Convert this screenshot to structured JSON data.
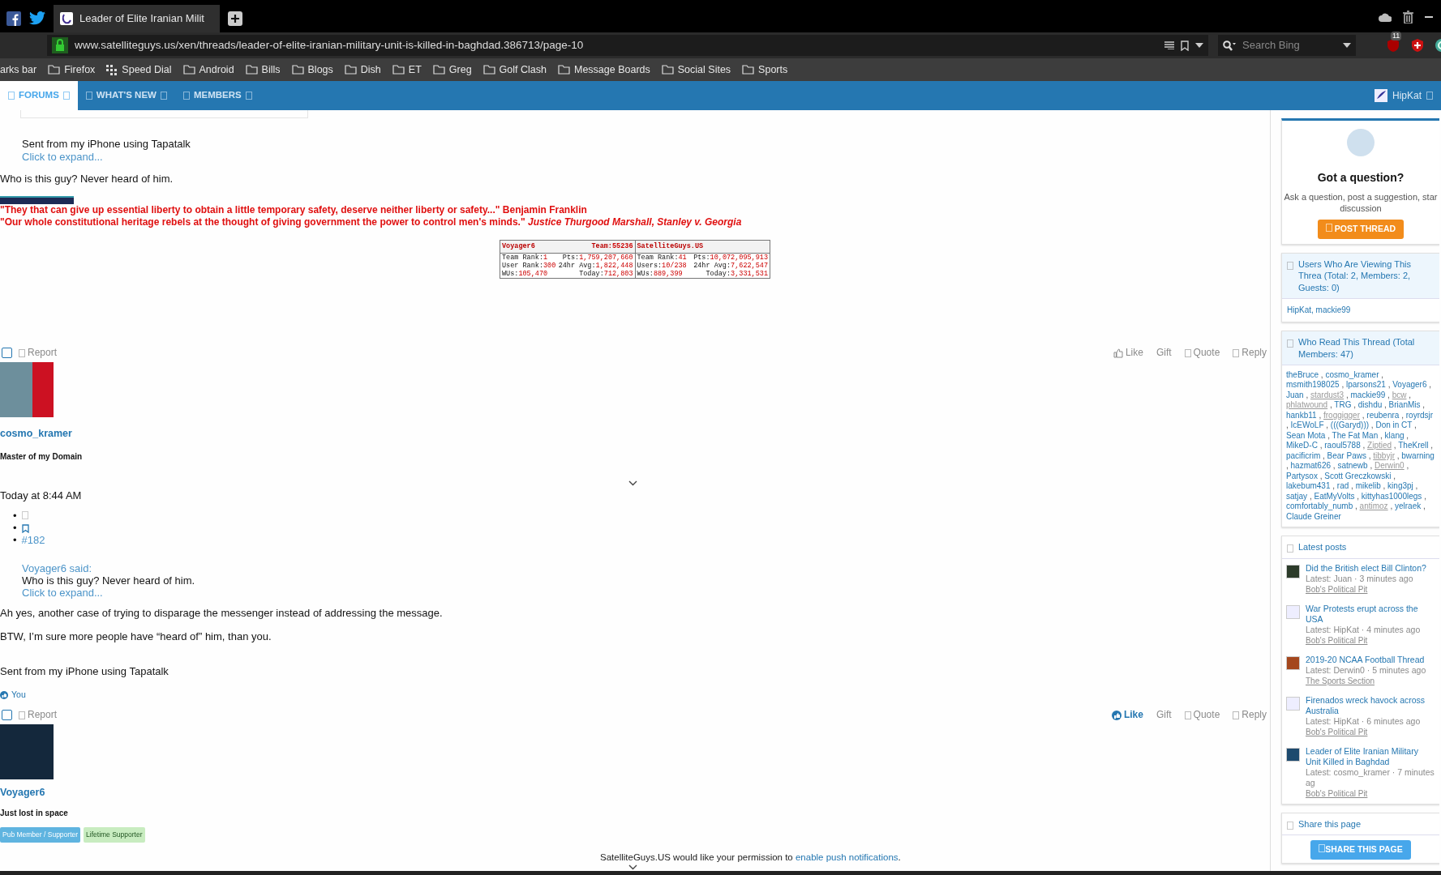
{
  "browser": {
    "tabs": [
      {
        "title": "Leader of Elite Iranian Milit",
        "selected": true
      }
    ],
    "url": "www.satelliteguys.us/xen/threads/leader-of-elite-iranian-military-unit-is-killed-in-baghdad.386713/page-10",
    "search": {
      "placeholder": "Search Bing"
    },
    "extension_badge": "11",
    "bookmarks": [
      {
        "label": "arks bar",
        "kind": "text"
      },
      {
        "label": "Firefox",
        "kind": "folder"
      },
      {
        "label": "Speed Dial",
        "kind": "grid"
      },
      {
        "label": "Android",
        "kind": "folder"
      },
      {
        "label": "Bills",
        "kind": "folder"
      },
      {
        "label": "Blogs",
        "kind": "folder"
      },
      {
        "label": "Dish",
        "kind": "folder"
      },
      {
        "label": "ET",
        "kind": "folder"
      },
      {
        "label": "Greg",
        "kind": "folder"
      },
      {
        "label": "Golf Clash",
        "kind": "folder"
      },
      {
        "label": "Message Boards",
        "kind": "folder"
      },
      {
        "label": "Social Sites",
        "kind": "folder"
      },
      {
        "label": "Sports",
        "kind": "folder"
      }
    ]
  },
  "site_nav": {
    "items": [
      {
        "label": "FORUMS",
        "selected": true
      },
      {
        "label": "WHAT'S NEW",
        "selected": false
      },
      {
        "label": "MEMBERS",
        "selected": false
      }
    ],
    "user": "HipKat"
  },
  "top_post": {
    "quote_footer": "Sent from my iPhone using Tapatalk",
    "expand": "Click to expand...",
    "body": "Who is this guy? Never heard of him.",
    "signature": [
      "\"They that can give up essential liberty to obtain a little temporary safety, deserve neither liberty or safety...\" Benjamin Franklin",
      "\"Our whole constitutional heritage rebels at the thought of giving government the power to control men's minds.\" *Justice Thurgood Marshall, Stanley v. Georgia*"
    ],
    "stats": [
      {
        "name": "Voyager6",
        "label": "Team:",
        "value": "55236",
        "rows": [
          [
            [
              "Team Rank:",
              "1"
            ],
            [
              "Pts:",
              "1,759,207,660"
            ]
          ],
          [
            [
              "User Rank:",
              "300"
            ],
            [
              "24hr Avg:",
              "1,822,448"
            ]
          ],
          [
            [
              "WUs:",
              "105,470"
            ],
            [
              "Today:",
              "712,803"
            ]
          ]
        ]
      },
      {
        "name": "SatelliteGuys.US",
        "rows": [
          [
            [
              "Team Rank:",
              "41"
            ],
            [
              "Pts:",
              "10,072,095,913"
            ]
          ],
          [
            [
              "Users:",
              "10/238"
            ],
            [
              "24hr Avg:",
              "7,622,547"
            ]
          ],
          [
            [
              "WUs:",
              "889,399"
            ],
            [
              "Today:",
              "3,331,531"
            ]
          ]
        ]
      }
    ],
    "actions": {
      "selected": false,
      "report": "Report",
      "liked": false,
      "like": "Like",
      "gift": "Gift",
      "quote": "Quote",
      "reply": "Reply"
    }
  },
  "post": {
    "author": "cosmo_kramer",
    "user_title": "Master of my Domain",
    "date": "Today at 8:44 AM",
    "post_number": "#182",
    "bullet": "•",
    "quote": {
      "source": "Voyager6 said:",
      "text": "Who is this guy? Never heard of him.",
      "expand": "Click to expand..."
    },
    "paragraphs": [
      "Ah yes, another case of trying to disparage the messenger instead of addressing the message.",
      "BTW, I’m sure more people have “heard of” him, than you.",
      "Sent from my iPhone using Tapatalk"
    ],
    "reactions": "You",
    "actions": {
      "selected": false,
      "report": "Report",
      "liked": true,
      "like": "Like",
      "gift": "Gift",
      "quote": "Quote",
      "reply": "Reply"
    }
  },
  "next_post": {
    "author": "Voyager6",
    "user_title": "Just lost in space",
    "banners": [
      {
        "label": "Pub Member / Supporter",
        "color": "#5fb4e0"
      },
      {
        "label": "Lifetime Supporter",
        "color": "#c8ecc0"
      }
    ]
  },
  "notice": {
    "text": "SatelliteGuys.US would like your permission to ",
    "link": "enable push notifications",
    "end": "."
  },
  "sidebar": {
    "question": {
      "title": "Got a question?",
      "text": "Ask a question, post a suggestion, star discussion",
      "button": "POST THREAD"
    },
    "viewing": {
      "title": "Users Who Are Viewing This Threa (Total: 2, Members: 2, Guests: 0)",
      "users": "HipKat, mackie99"
    },
    "readers": {
      "title": "Who Read This Thread (Total Members: 47)",
      "names": [
        {
          "name": "theBruce",
          "muted": false
        },
        {
          "name": "cosmo_kramer",
          "muted": false
        },
        {
          "name": "msmith198025",
          "muted": false
        },
        {
          "name": "lparsons21",
          "muted": false
        },
        {
          "name": "Voyager6",
          "muted": false
        },
        {
          "name": "Juan",
          "muted": false
        },
        {
          "name": "stardust3",
          "muted": true
        },
        {
          "name": "mackie99",
          "muted": false
        },
        {
          "name": "bcw",
          "muted": true
        },
        {
          "name": "phlatwound",
          "muted": true
        },
        {
          "name": "TRG",
          "muted": false
        },
        {
          "name": "dishdu",
          "muted": false
        },
        {
          "name": "BrianMis",
          "muted": false
        },
        {
          "name": "hankb11",
          "muted": false
        },
        {
          "name": "froggigger",
          "muted": true
        },
        {
          "name": "reubenra",
          "muted": false
        },
        {
          "name": "royrdsjr",
          "muted": false
        },
        {
          "name": "IcEWoLF",
          "muted": false
        },
        {
          "name": "(((Garyd)))",
          "muted": false
        },
        {
          "name": "Don in CT",
          "muted": false
        },
        {
          "name": "Sean Mota",
          "muted": false
        },
        {
          "name": "The Fat Man",
          "muted": false
        },
        {
          "name": "klang",
          "muted": false
        },
        {
          "name": "MikeD-C",
          "muted": false
        },
        {
          "name": "raoul5788",
          "muted": false
        },
        {
          "name": "Ziptied",
          "muted": true
        },
        {
          "name": "TheKrell",
          "muted": false
        },
        {
          "name": "pacificrim",
          "muted": false
        },
        {
          "name": "Bear Paws",
          "muted": false
        },
        {
          "name": "tibbyjr",
          "muted": true
        },
        {
          "name": "bwarning",
          "muted": false
        },
        {
          "name": "hazmat626",
          "muted": false
        },
        {
          "name": "satnewb",
          "muted": false
        },
        {
          "name": "Derwin0",
          "muted": true
        },
        {
          "name": "Partysox",
          "muted": false
        },
        {
          "name": "Scott Greczkowski",
          "muted": false
        },
        {
          "name": "lakebum431",
          "muted": false
        },
        {
          "name": "rad",
          "muted": false
        },
        {
          "name": "mikelib",
          "muted": false
        },
        {
          "name": "king3pj",
          "muted": false
        },
        {
          "name": "satjay",
          "muted": false
        },
        {
          "name": "EatMyVolts",
          "muted": false
        },
        {
          "name": "kittyhas1000legs",
          "muted": false
        },
        {
          "name": "comfortably_numb",
          "muted": false
        },
        {
          "name": "antimoz",
          "muted": true
        },
        {
          "name": "yelraek",
          "muted": false
        },
        {
          "name": "Claude Greiner",
          "muted": false
        }
      ],
      "separator": ","
    },
    "latest": {
      "title": "Latest posts",
      "items": [
        {
          "title": "Did the British elect Bill Clinton?",
          "meta": "Latest: Juan · 3 minutes ago",
          "forum": "Bob's Political Pit"
        },
        {
          "title": "War Protests erupt across the USA",
          "meta": "Latest: HipKat · 4 minutes ago",
          "forum": "Bob's Political Pit"
        },
        {
          "title": "2019-20 NCAA Football Thread",
          "meta": "Latest: Derwin0 · 5 minutes ago",
          "forum": "The Sports Section"
        },
        {
          "title": "Firenados wreck havock across Australia",
          "meta": "Latest: HipKat · 6 minutes ago",
          "forum": "Bob's Political Pit"
        },
        {
          "title": "Leader of Elite Iranian Military Unit Killed in Baghdad",
          "meta": "Latest: cosmo_kramer · 7 minutes ag",
          "forum": "Bob's Political Pit"
        }
      ]
    },
    "share": {
      "title": "Share this page",
      "button": "SHARE THIS PAGE"
    }
  }
}
